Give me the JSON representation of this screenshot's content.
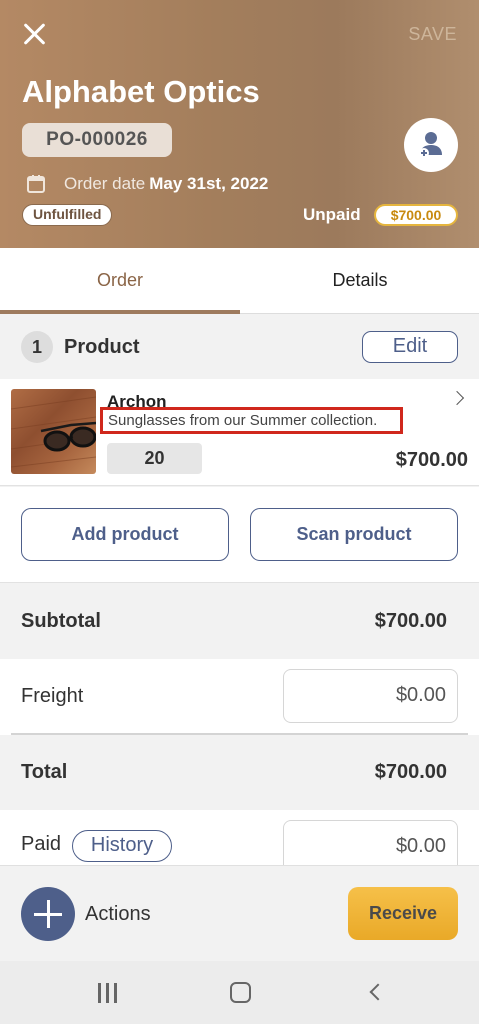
{
  "header": {
    "save_label": "SAVE",
    "supplier_name": "Alphabet Optics",
    "po_number": "PO-000026",
    "order_date_label": "Order date",
    "order_date_value": "May 31st, 2022",
    "fulfillment_status": "Unfulfilled",
    "payment_status": "Unpaid",
    "amount_due": "$700.00",
    "icons": {
      "close": "close-icon",
      "calendar": "calendar-icon",
      "assign": "add-contact-icon"
    },
    "colors": {
      "accent": "#9e7b5e",
      "due_badge": "#e5b53e"
    }
  },
  "tabs": [
    {
      "label": "Order",
      "active": true
    },
    {
      "label": "Details",
      "active": false
    }
  ],
  "products": {
    "count": "1",
    "title": "Product",
    "edit_label": "Edit",
    "items": [
      {
        "name": "Archon",
        "description": "Sunglasses from our Summer collection.",
        "quantity": "20",
        "line_total": "$700.00"
      }
    ],
    "add_label": "Add product",
    "scan_label": "Scan product"
  },
  "summary": {
    "subtotal_label": "Subtotal",
    "subtotal_value": "$700.00",
    "freight_label": "Freight",
    "freight_value": "$0.00",
    "total_label": "Total",
    "total_value": "$700.00",
    "paid_label": "Paid",
    "history_label": "History",
    "paid_value": "$0.00"
  },
  "footer": {
    "actions_label": "Actions",
    "receive_label": "Receive",
    "colors": {
      "primary": "#4e5f8a",
      "receive": "#f0b43a"
    }
  }
}
